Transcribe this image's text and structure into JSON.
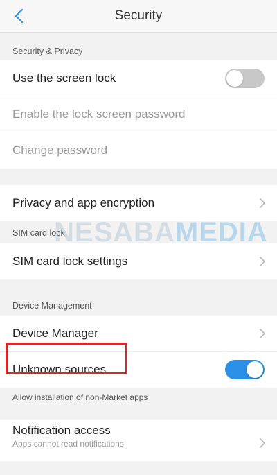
{
  "header": {
    "title": "Security"
  },
  "sections": {
    "security_privacy": {
      "label": "Security & Privacy",
      "items": [
        {
          "label": "Use the screen lock",
          "toggle": "off"
        },
        {
          "label": "Enable the lock screen password",
          "state": "disabled"
        },
        {
          "label": "Change password",
          "state": "disabled"
        }
      ]
    },
    "privacy": {
      "label": "Privacy and app encryption"
    },
    "sim": {
      "label": "SIM card lock",
      "item": "SIM card lock settings"
    },
    "device": {
      "label": "Device Management",
      "device_manager": "Device Manager",
      "unknown_sources": "Unknown sources",
      "unknown_sources_toggle": "on",
      "hint": "Allow installation of non-Market apps"
    },
    "notification": {
      "label": "Notification access",
      "sub": "Apps cannot read notifications"
    }
  },
  "watermark": {
    "part1": "NESABA",
    "part2": "MEDIA"
  },
  "colors": {
    "accent": "#2a8fe6",
    "highlight": "#d42a2a"
  },
  "icons": {
    "back": "chevron-left-icon",
    "row_arrow": "chevron-right-icon"
  }
}
